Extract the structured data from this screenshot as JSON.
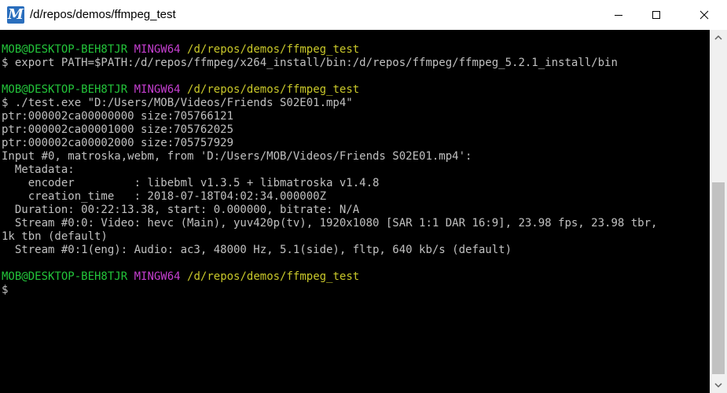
{
  "window": {
    "title": "/d/repos/demos/ffmpeg_test",
    "app_icon_letter": "M",
    "controls": [
      "minimize",
      "maximize",
      "close"
    ]
  },
  "terminal": {
    "colors": {
      "background": "#000000",
      "text": "#c0c0c0",
      "user_host": "#23c43a",
      "shell": "#c63fd1",
      "path": "#c9c82a"
    },
    "blocks": [
      {
        "prompt": {
          "user_host": "MOB@DESKTOP-BEH8TJR",
          "shell": "MINGW64",
          "path": "/d/repos/demos/ffmpeg_test"
        },
        "command": "$ export PATH=$PATH:/d/repos/ffmpeg/x264_install/bin:/d/repos/ffmpeg/ffmpeg_5.2.1_install/bin",
        "output": []
      },
      {
        "prompt": {
          "user_host": "MOB@DESKTOP-BEH8TJR",
          "shell": "MINGW64",
          "path": "/d/repos/demos/ffmpeg_test"
        },
        "command": "$ ./test.exe \"D:/Users/MOB/Videos/Friends S02E01.mp4\"",
        "output": [
          "ptr:000002ca00000000 size:705766121",
          "ptr:000002ca00001000 size:705762025",
          "ptr:000002ca00002000 size:705757929",
          "Input #0, matroska,webm, from 'D:/Users/MOB/Videos/Friends S02E01.mp4':",
          "  Metadata:",
          "    encoder         : libebml v1.3.5 + libmatroska v1.4.8",
          "    creation_time   : 2018-07-18T04:02:34.000000Z",
          "  Duration: 00:22:13.38, start: 0.000000, bitrate: N/A",
          "  Stream #0:0: Video: hevc (Main), yuv420p(tv), 1920x1080 [SAR 1:1 DAR 16:9], 23.98 fps, 23.98 tbr,",
          "1k tbn (default)",
          "  Stream #0:1(eng): Audio: ac3, 48000 Hz, 5.1(side), fltp, 640 kb/s (default)"
        ]
      },
      {
        "prompt": {
          "user_host": "MOB@DESKTOP-BEH8TJR",
          "shell": "MINGW64",
          "path": "/d/repos/demos/ffmpeg_test"
        },
        "command": "$",
        "output": []
      }
    ]
  }
}
